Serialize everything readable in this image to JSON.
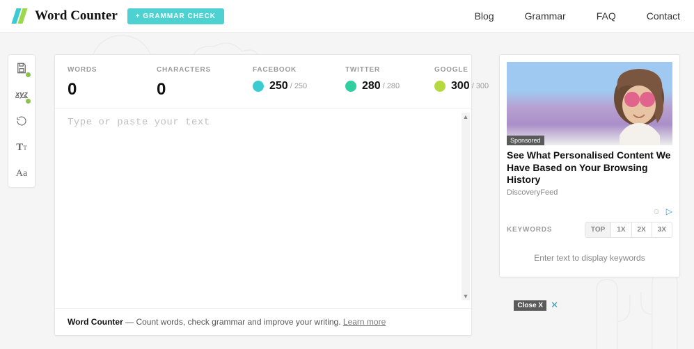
{
  "header": {
    "brand": "Word Counter",
    "badge": "+ GRAMMAR CHECK",
    "nav": [
      "Blog",
      "Grammar",
      "FAQ",
      "Contact"
    ]
  },
  "logo": {
    "stripe1": "#3accd2",
    "stripe2": "#9bd84c"
  },
  "stats": {
    "words_label": "WORDS",
    "words_value": "0",
    "chars_label": "CHARACTERS",
    "chars_value": "0",
    "facebook_label": "FACEBOOK",
    "facebook_value": "250",
    "facebook_max": "/ 250",
    "facebook_color": "#3accd2",
    "twitter_label": "TWITTER",
    "twitter_value": "280",
    "twitter_max": "/ 280",
    "twitter_color": "#2fcfa0",
    "google_label": "GOOGLE",
    "google_value": "300",
    "google_max": "/ 300",
    "google_color": "#b6d93f"
  },
  "editor": {
    "placeholder": "Type or paste your text"
  },
  "footer": {
    "brand": "Word Counter",
    "dash": " — ",
    "text": "Count words, check grammar and improve your writing. ",
    "link": "Learn more"
  },
  "ad": {
    "tag": "Sponsored",
    "headline": "See What Personalised Content We Have Based on Your Browsing History",
    "source": "DiscoveryFeed"
  },
  "keywords": {
    "label": "KEYWORDS",
    "tabs": [
      "TOP",
      "1X",
      "2X",
      "3X"
    ],
    "empty": "Enter text to display keywords"
  },
  "ad_close": {
    "label": "Close X"
  }
}
